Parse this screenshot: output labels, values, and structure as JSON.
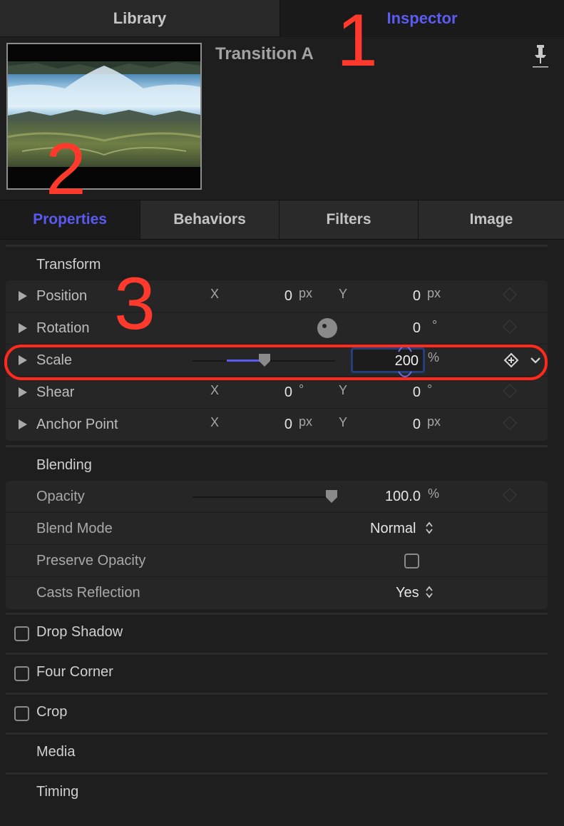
{
  "top_tabs": {
    "library": "Library",
    "inspector": "Inspector"
  },
  "header": {
    "title": "Transition A"
  },
  "annotations": {
    "a1": "1",
    "a2": "2",
    "a3": "3"
  },
  "sub_tabs": [
    "Properties",
    "Behaviors",
    "Filters",
    "Image"
  ],
  "transform": {
    "title": "Transform",
    "position": {
      "label": "Position",
      "x_axis": "X",
      "x_value": "0",
      "x_unit": "px",
      "y_axis": "Y",
      "y_value": "0",
      "y_unit": "px"
    },
    "rotation": {
      "label": "Rotation",
      "value": "0",
      "unit": "°"
    },
    "scale": {
      "label": "Scale",
      "value": "200",
      "unit": "%"
    },
    "shear": {
      "label": "Shear",
      "x_axis": "X",
      "x_value": "0",
      "x_unit": "°",
      "y_axis": "Y",
      "y_value": "0",
      "y_unit": "°"
    },
    "anchor": {
      "label": "Anchor Point",
      "x_axis": "X",
      "x_value": "0",
      "x_unit": "px",
      "y_axis": "Y",
      "y_value": "0",
      "y_unit": "px"
    }
  },
  "blending": {
    "title": "Blending",
    "opacity": {
      "label": "Opacity",
      "value": "100.0",
      "unit": "%"
    },
    "blend_mode": {
      "label": "Blend Mode",
      "value": "Normal"
    },
    "preserve_opacity": {
      "label": "Preserve Opacity",
      "checked": false
    },
    "casts_reflection": {
      "label": "Casts Reflection",
      "value": "Yes"
    }
  },
  "sections": {
    "drop_shadow": "Drop Shadow",
    "four_corner": "Four Corner",
    "crop": "Crop",
    "media": "Media",
    "timing": "Timing"
  },
  "colors": {
    "accent": "#5a5af0",
    "annotation": "#ff3a2c"
  }
}
